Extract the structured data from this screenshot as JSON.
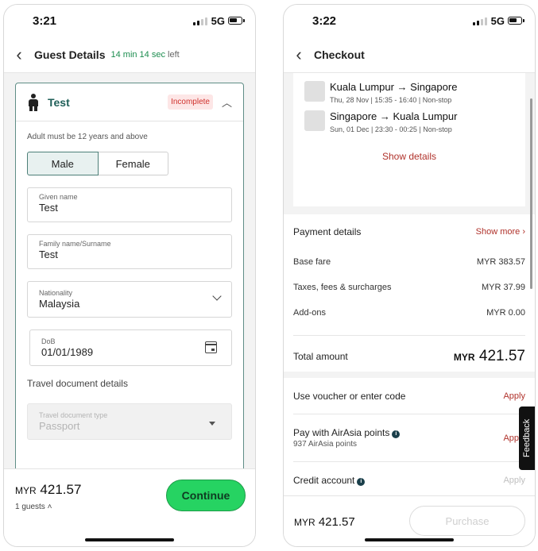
{
  "left": {
    "status": {
      "time": "3:21",
      "network": "5G"
    },
    "header": {
      "title": "Guest Details",
      "timer": "14 min 14 sec",
      "timer_suffix": "left"
    },
    "guest": {
      "name": "Test",
      "badge": "Incomplete"
    },
    "form": {
      "hint": "Adult must be 12 years and above",
      "gender_male": "Male",
      "gender_female": "Female",
      "given_name_label": "Given name",
      "given_name_value": "Test",
      "family_name_label": "Family name/Surname",
      "family_name_value": "Test",
      "nationality_label": "Nationality",
      "nationality_value": "Malaysia",
      "dob_label": "DoB",
      "dob_value": "01/01/1989",
      "travel_doc_heading": "Travel document details",
      "doc_type_label": "Travel document type",
      "doc_type_value": "Passport"
    },
    "footer": {
      "currency": "MYR",
      "amount": "421.57",
      "guests": "1 guests",
      "continue": "Continue"
    }
  },
  "right": {
    "status": {
      "time": "3:22",
      "network": "5G"
    },
    "header": {
      "title": "Checkout"
    },
    "flights": [
      {
        "route": "Kuala Lumpur → Singapore",
        "meta": "Thu, 28 Nov  |  15:35 - 16:40  |  Non-stop"
      },
      {
        "route": "Singapore → Kuala Lumpur",
        "meta": "Sun, 01 Dec  |  23:30 - 00:25  |  Non-stop"
      }
    ],
    "show_details": "Show details",
    "payment": {
      "heading": "Payment details",
      "show_more": "Show more",
      "base_fare_label": "Base fare",
      "base_fare_value": "MYR 383.57",
      "taxes_label": "Taxes, fees & surcharges",
      "taxes_value": "MYR 37.99",
      "addons_label": "Add-ons",
      "addons_value": "MYR 0.00",
      "total_label": "Total amount",
      "total_currency": "MYR",
      "total_amount": "421.57"
    },
    "options": {
      "voucher_label": "Use voucher or enter code",
      "voucher_apply": "Apply",
      "points_label": "Pay with AirAsia points",
      "points_sub": "937 AirAsia points",
      "points_apply": "Apply",
      "credit_label": "Credit account",
      "credit_apply": "Apply"
    },
    "feedback": "Feedback",
    "footer": {
      "currency": "MYR",
      "amount": "421.57",
      "purchase": "Purchase"
    }
  },
  "colors": {
    "brand_red": "#b0322b",
    "success_green": "#26d362",
    "teal": "#1f5f58"
  },
  "icons": [
    "back-chevron-icon",
    "person-icon",
    "chevron-up-icon",
    "chevron-down-icon",
    "calendar-icon",
    "dropdown-triangle-icon",
    "info-icon",
    "signal-icon",
    "battery-icon"
  ]
}
